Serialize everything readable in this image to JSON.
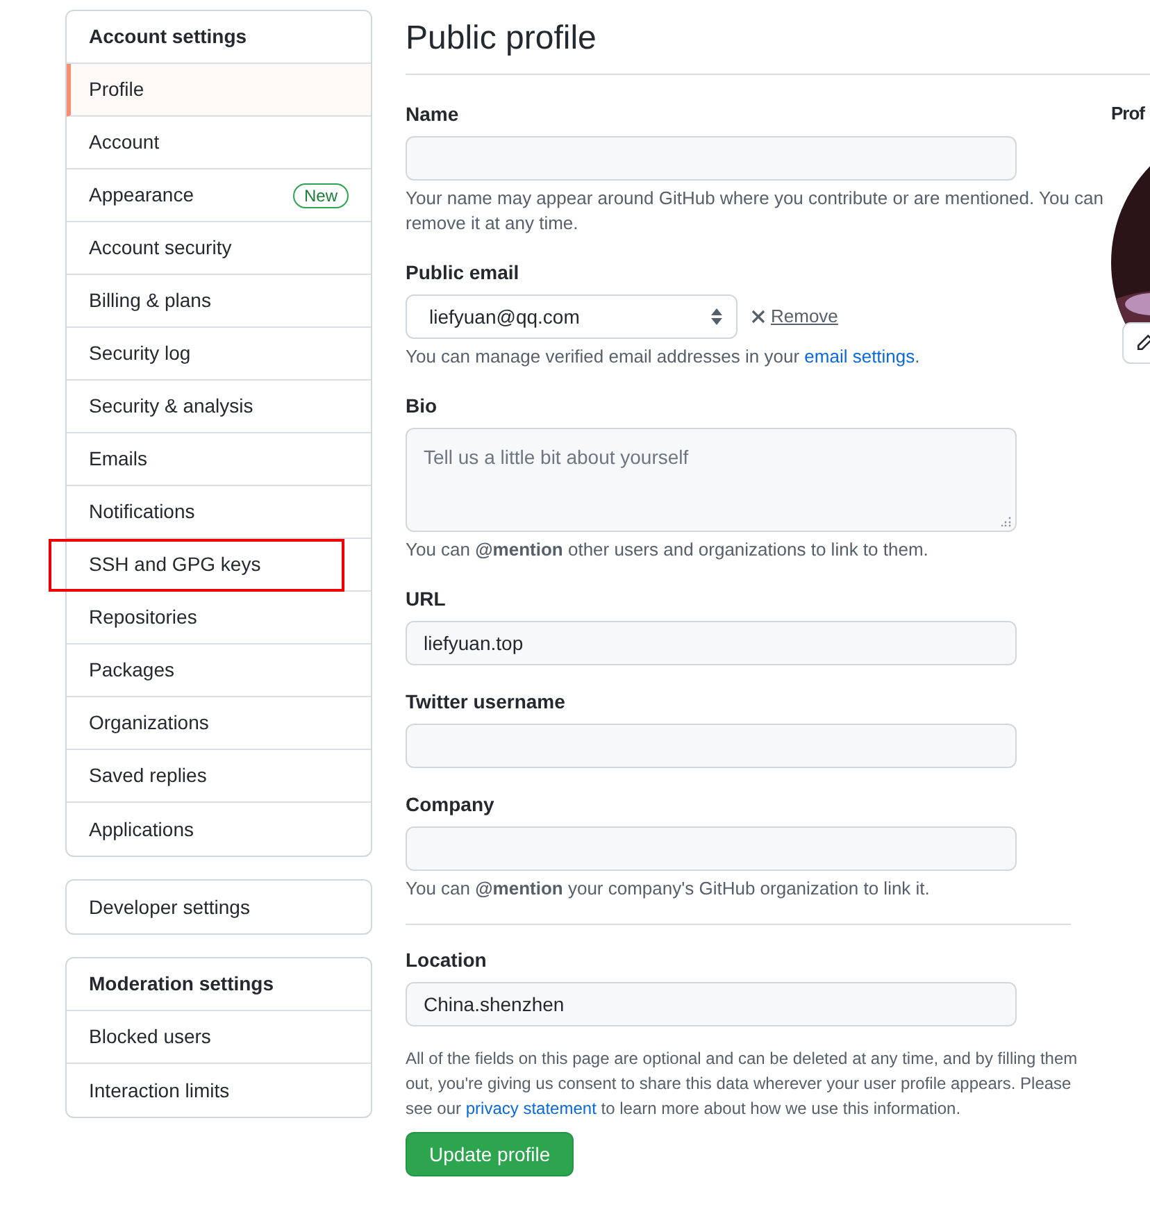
{
  "sidebar": {
    "sections": [
      {
        "title": "Account settings",
        "items": [
          {
            "label": "Profile",
            "selected": true,
            "annotated": false
          },
          {
            "label": "Account",
            "selected": false,
            "annotated": false
          },
          {
            "label": "Appearance",
            "selected": false,
            "annotated": false,
            "badge": "New"
          },
          {
            "label": "Account security",
            "selected": false,
            "annotated": false
          },
          {
            "label": "Billing & plans",
            "selected": false,
            "annotated": false
          },
          {
            "label": "Security log",
            "selected": false,
            "annotated": false
          },
          {
            "label": "Security & analysis",
            "selected": false,
            "annotated": false
          },
          {
            "label": "Emails",
            "selected": false,
            "annotated": false
          },
          {
            "label": "Notifications",
            "selected": false,
            "annotated": false
          },
          {
            "label": "SSH and GPG keys",
            "selected": false,
            "annotated": true
          },
          {
            "label": "Repositories",
            "selected": false,
            "annotated": false
          },
          {
            "label": "Packages",
            "selected": false,
            "annotated": false
          },
          {
            "label": "Organizations",
            "selected": false,
            "annotated": false
          },
          {
            "label": "Saved replies",
            "selected": false,
            "annotated": false
          },
          {
            "label": "Applications",
            "selected": false,
            "annotated": false
          }
        ]
      },
      {
        "items": [
          {
            "label": "Developer settings",
            "selected": false,
            "annotated": false
          }
        ]
      },
      {
        "title": "Moderation settings",
        "items": [
          {
            "label": "Blocked users",
            "selected": false,
            "annotated": false
          },
          {
            "label": "Interaction limits",
            "selected": false,
            "annotated": false
          }
        ]
      }
    ]
  },
  "page": {
    "title": "Public profile"
  },
  "form": {
    "fields": [
      {
        "kind": "text",
        "label": "Name",
        "hint": "Your name may appear around GitHub where you contribute or are mentioned. You can remove it at any time."
      },
      {
        "kind": "select",
        "label": "Public email",
        "value": "liefyuan@qq.com",
        "action": "Remove",
        "hint": "You can manage verified email addresses in your",
        "hint_link": "email settings",
        "hint_after": "."
      },
      {
        "kind": "textarea",
        "label": "Bio",
        "placeholder": "Tell us a little bit about yourself",
        "hint": "You can **@mention** other users and organizations to link to them."
      },
      {
        "kind": "text",
        "label": "URL",
        "value": "liefyuan.top"
      },
      {
        "kind": "text",
        "label": "Twitter username"
      },
      {
        "kind": "text",
        "label": "Company",
        "hint": "You can **@mention** your company's GitHub organization to link it."
      },
      {
        "kind": "divider"
      },
      {
        "kind": "text",
        "label": "Location",
        "value": "China.shenzhen"
      }
    ],
    "note": {
      "before": "All of the fields on this page are optional and can be deleted at any time, and by filling them out, you're giving us consent to share this data wherever your user profile appears. Please see our",
      "link": "privacy statement",
      "after": "to learn more about how we use this information."
    },
    "submit": "Update profile"
  },
  "picture_panel": {
    "label": "Prof"
  }
}
